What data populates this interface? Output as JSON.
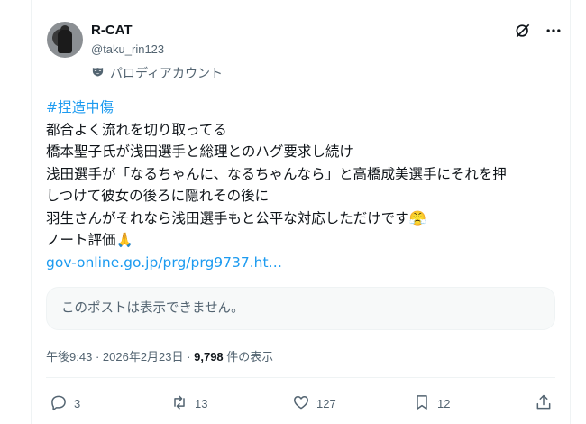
{
  "author": {
    "display_name": "R-CAT",
    "handle": "@taku_rin123",
    "parody_label": "パロディアカウント"
  },
  "post": {
    "hashtag": "#捏造中傷",
    "lines": [
      "都合よく流れを切り取ってる",
      "橋本聖子氏が浅田選手と総理とのハグ要求し続け",
      "浅田選手が「なるちゃんに、なるちゃんなら」と高橋成美選手にそれを押",
      "しつけて彼女の後ろに隠れその後に",
      "羽生さんがそれなら浅田選手もと公平な対応しただけです😤",
      "ノート評価🙏"
    ],
    "link_text": "gov-online.go.jp/prg/prg9737.ht…",
    "quote_unavailable": "このポストは表示できません。"
  },
  "meta": {
    "time": "午後9:43",
    "separator": "·",
    "date": "2026年2月23日",
    "views_count": "9,798",
    "views_label": "件の表示"
  },
  "actions": {
    "replies": "3",
    "reposts": "13",
    "likes": "127",
    "bookmarks": "12"
  },
  "icons": [
    "grok-icon",
    "more-icon",
    "parody-mask-icon",
    "reply-icon",
    "repost-icon",
    "like-icon",
    "bookmark-icon",
    "share-icon"
  ],
  "colors": {
    "link": "#1d9bf0",
    "secondary_text": "#536471",
    "primary_text": "#0f1419"
  }
}
